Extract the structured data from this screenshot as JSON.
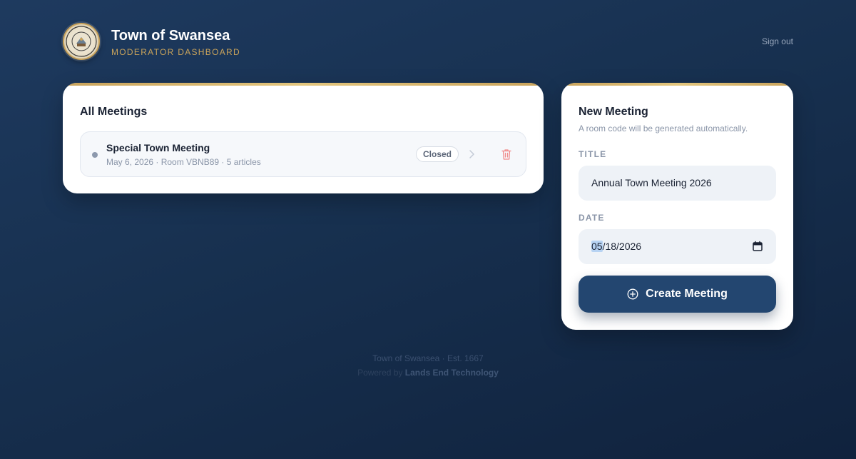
{
  "header": {
    "title": "Town of Swansea",
    "subtitle": "MODERATOR DASHBOARD",
    "signout_label": "Sign out",
    "seal_icon": "town-seal-icon"
  },
  "meetings": {
    "heading": "All Meetings",
    "items": [
      {
        "name": "Special Town Meeting",
        "meta": "May 6, 2026 · Room VBNB89 · 5 articles",
        "status": "Closed"
      }
    ]
  },
  "new_meeting": {
    "heading": "New Meeting",
    "subtext": "A room code will be generated automatically.",
    "title_label": "TITLE",
    "title_value": "Annual Town Meeting 2026",
    "date_label": "DATE",
    "date_month": "05",
    "date_rest": "/18/2026",
    "create_label": "Create Meeting"
  },
  "footer": {
    "line1": "Town of Swansea · Est. 1667",
    "powered_prefix": "Powered by",
    "powered_company": "Lands End Technology"
  },
  "colors": {
    "accent_gold": "#c9a35b",
    "primary_navy": "#234670",
    "danger": "#f08a8a"
  }
}
